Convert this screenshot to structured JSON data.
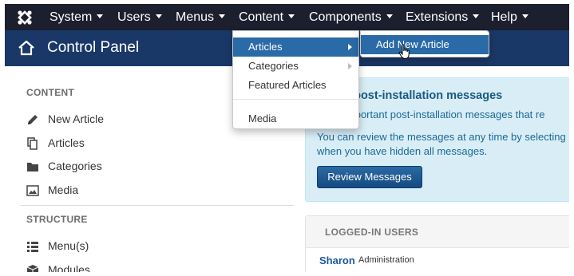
{
  "navbar": {
    "logo_icon": "joomla-logo-icon",
    "items": [
      {
        "label": "System"
      },
      {
        "label": "Users"
      },
      {
        "label": "Menus"
      },
      {
        "label": "Content"
      },
      {
        "label": "Components"
      },
      {
        "label": "Extensions"
      },
      {
        "label": "Help"
      }
    ]
  },
  "header": {
    "icon": "home-icon",
    "title": "Control Panel"
  },
  "sidebar": {
    "content_heading": "CONTENT",
    "content_items": [
      {
        "label": "New Article",
        "icon": "pencil-icon"
      },
      {
        "label": "Articles",
        "icon": "copy-icon"
      },
      {
        "label": "Categories",
        "icon": "folder-icon"
      },
      {
        "label": "Media",
        "icon": "picture-icon"
      }
    ],
    "structure_heading": "STRUCTURE",
    "structure_items": [
      {
        "label": "Menu(s)",
        "icon": "list-icon"
      },
      {
        "label": "Modules",
        "icon": "cube-icon"
      }
    ]
  },
  "post_install": {
    "title": "e post-installation messages",
    "line1": "important post-installation messages that re",
    "line2": "You can review the messages at any time by selecting",
    "line3": "when you have hidden all messages.",
    "button_label": "Review Messages"
  },
  "logged_in_users": {
    "heading": "LOGGED-IN USERS",
    "users": [
      {
        "name": "Sharon",
        "role": "Administration"
      }
    ]
  },
  "content_menu": {
    "items": [
      {
        "label": "Articles"
      },
      {
        "label": "Categories"
      },
      {
        "label": "Featured Articles"
      },
      {
        "label": "Media"
      }
    ]
  },
  "articles_submenu": {
    "items": [
      {
        "label": "Add New Article"
      }
    ]
  },
  "colors": {
    "navbar_bg": "#1b1f2e",
    "header_bg": "#1a3867",
    "menu_active": "#2a6aa7",
    "info_bg": "#d9edf7"
  }
}
